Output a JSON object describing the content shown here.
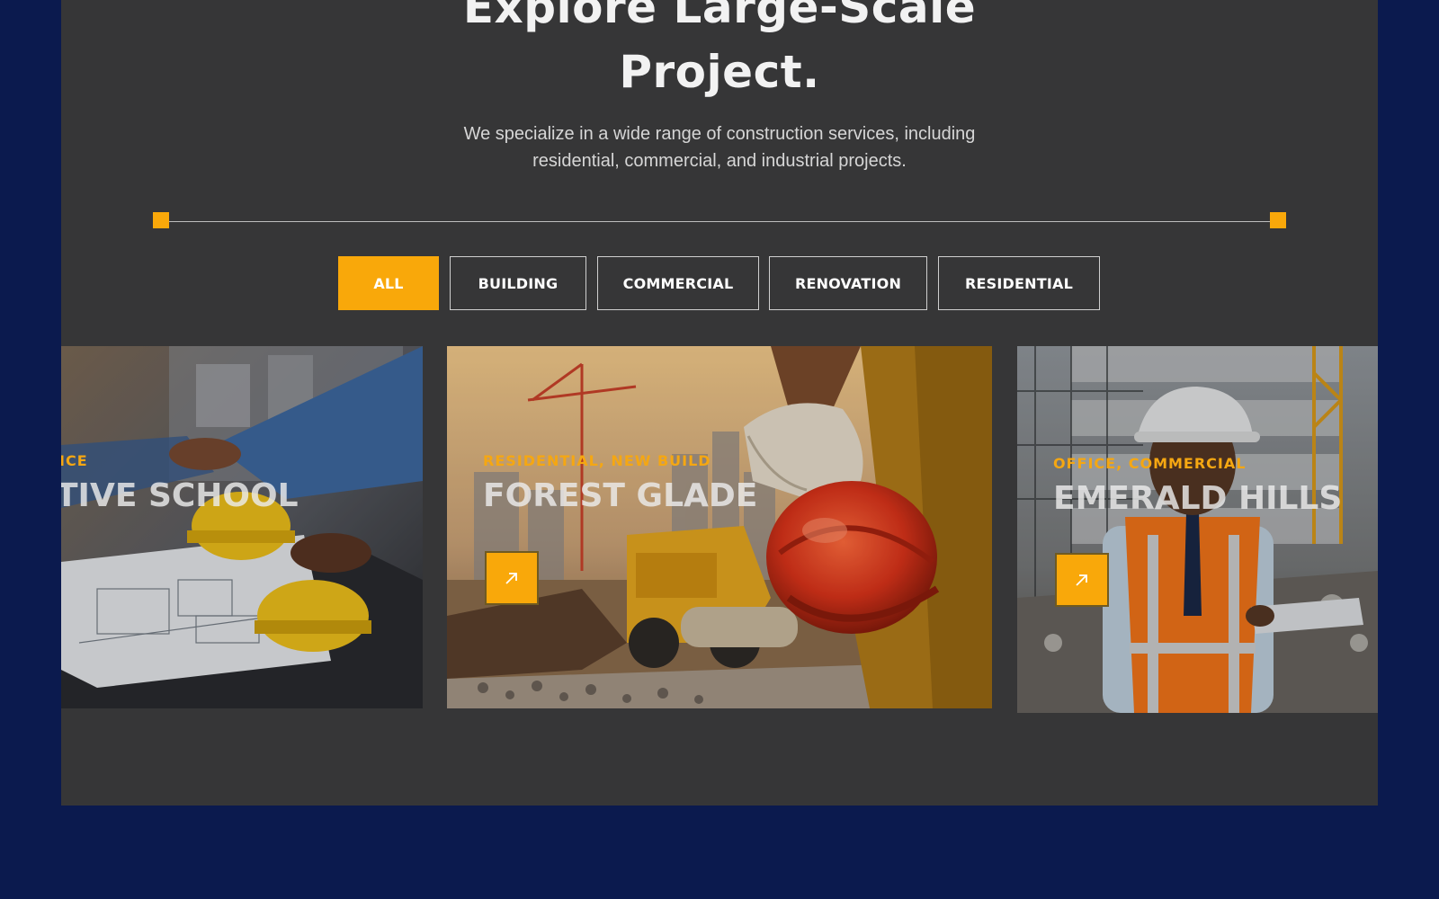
{
  "section": {
    "headline_line1": "Explore Large-Scale",
    "headline_line2": "Project.",
    "subtitle_line1": "We specialize in a wide range of construction services, including",
    "subtitle_line2": "residential, commercial, and industrial projects."
  },
  "filters": [
    {
      "label": "ALL",
      "active": true
    },
    {
      "label": "BUILDING",
      "active": false
    },
    {
      "label": "COMMERCIAL",
      "active": false
    },
    {
      "label": "RENOVATION",
      "active": false
    },
    {
      "label": "RESIDENTIAL",
      "active": false
    }
  ],
  "projects": [
    {
      "category": "ICE",
      "title": "TIVE SCHOOL"
    },
    {
      "category": "RESIDENTIAL, NEW BUILD",
      "title": "FOREST GLADE"
    },
    {
      "category": "OFFICE, COMMERCIAL",
      "title": "EMERALD HILLS"
    }
  ],
  "colors": {
    "background": "#0b1a4e",
    "panel": "#363637",
    "accent": "#f9a80a"
  },
  "icons": {
    "card_arrow": "arrow-up-right-icon"
  }
}
